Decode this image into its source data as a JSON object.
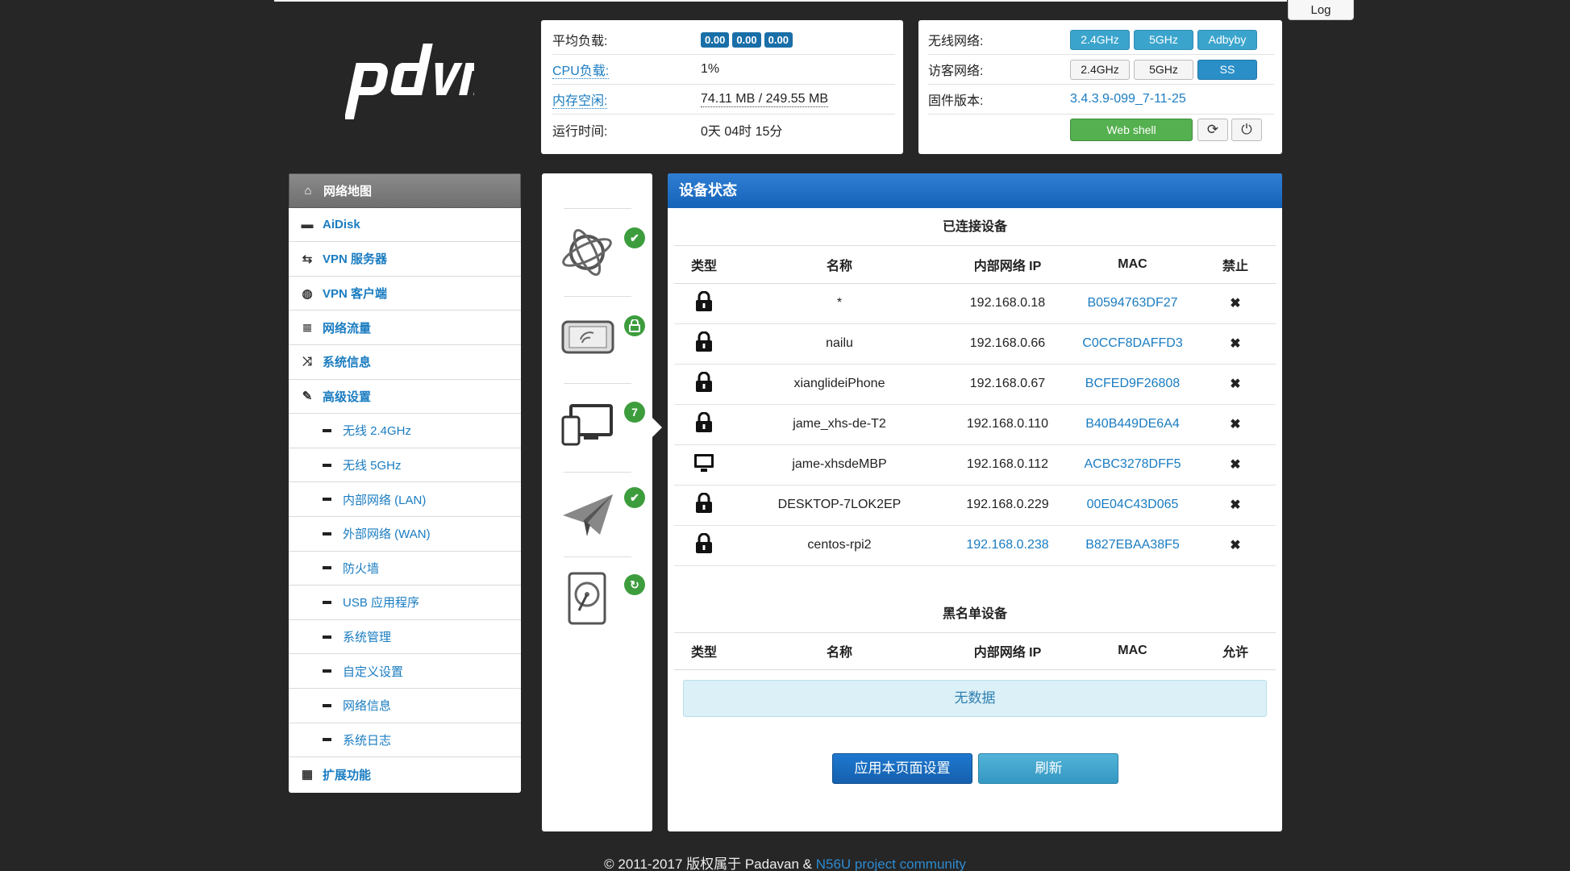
{
  "topbar": {
    "log_label": "Log"
  },
  "logo": {
    "text": "pdvn"
  },
  "system": {
    "load_label": "平均负载:",
    "load_values": [
      "0.00",
      "0.00",
      "0.00"
    ],
    "cpu_label": "CPU负载:",
    "cpu_value": "1%",
    "mem_label": "内存空闲:",
    "mem_value": "74.11 MB / 249.55 MB",
    "uptime_label": "运行时间:",
    "uptime_value": "0天 04时 15分"
  },
  "network": {
    "wireless_label": "无线网络:",
    "wireless_chips": [
      "2.4GHz",
      "5GHz",
      "Adbyby"
    ],
    "guest_label": "访客网络:",
    "guest_chips": [
      "2.4GHz",
      "5GHz",
      "SS"
    ],
    "fw_label": "固件版本:",
    "fw_value": "3.4.3.9-099_7-11-25",
    "webshell_label": "Web shell"
  },
  "sidebar": {
    "items": [
      {
        "label": "网络地图",
        "icon": "home-icon",
        "glyph": "⌂"
      },
      {
        "label": "AiDisk",
        "icon": "hdd-icon",
        "glyph": "▬"
      },
      {
        "label": "VPN 服务器",
        "icon": "retweet-icon",
        "glyph": "⇆"
      },
      {
        "label": "VPN 客户端",
        "icon": "globe-icon",
        "glyph": "◍"
      },
      {
        "label": "网络流量",
        "icon": "tasks-icon",
        "glyph": "≣"
      },
      {
        "label": "系统信息",
        "icon": "random-icon",
        "glyph": "⤨"
      },
      {
        "label": "高级设置",
        "icon": "wrench-icon",
        "glyph": "✎"
      }
    ],
    "subitems": [
      "无线 2.4GHz",
      "无线 5GHz",
      "内部网络 (LAN)",
      "外部网络 (WAN)",
      "防火墙",
      "USB 应用程序",
      "系统管理",
      "自定义设置",
      "网络信息",
      "系统日志"
    ],
    "extra": {
      "label": "扩展功能",
      "icon": "grid-icon",
      "glyph": "▦"
    }
  },
  "status_icons": {
    "internet_status": "✔",
    "wireless_status": "lock",
    "clients_count": "7",
    "vpn_status": "✔",
    "usb_status": "↻"
  },
  "main": {
    "title": "设备状态",
    "connected_title": "已连接设备",
    "headers": [
      "类型",
      "名称",
      "内部网络 IP",
      "MAC",
      "禁止"
    ],
    "devices": [
      {
        "type": "lock",
        "name": "*",
        "ip": "192.168.0.18",
        "mac": "B0594763DF27"
      },
      {
        "type": "lock",
        "name": "nailu",
        "ip": "192.168.0.66",
        "mac": "C0CCF8DAFFD3"
      },
      {
        "type": "lock",
        "name": "xianglideiPhone",
        "ip": "192.168.0.67",
        "mac": "BCFED9F26808"
      },
      {
        "type": "lock",
        "name": "jame_xhs-de-T2",
        "ip": "192.168.0.110",
        "mac": "B40B449DE6A4"
      },
      {
        "type": "desktop",
        "name": "jame-xhsdeMBP",
        "ip": "192.168.0.112",
        "mac": "ACBC3278DFF5"
      },
      {
        "type": "lock",
        "name": "DESKTOP-7LOK2EP",
        "ip": "192.168.0.229",
        "mac": "00E04C43D065"
      },
      {
        "type": "lock",
        "name": "centos-rpi2",
        "ip": "192.168.0.238",
        "mac": "B827EBAA38F5"
      }
    ],
    "block_glyph": "✖",
    "blacklist_title": "黑名单设备",
    "blacklist_headers": [
      "类型",
      "名称",
      "内部网络 IP",
      "MAC",
      "允许"
    ],
    "no_data": "无数据",
    "apply_label": "应用本页面设置",
    "refresh_label": "刷新"
  },
  "footer": {
    "text": "© 2011-2017 版权属于 Padavan & ",
    "link": "N56U project community"
  },
  "colors": {
    "accent": "#1a7cc1",
    "header_blue": "#1463b8",
    "success": "#3d9d3d"
  }
}
